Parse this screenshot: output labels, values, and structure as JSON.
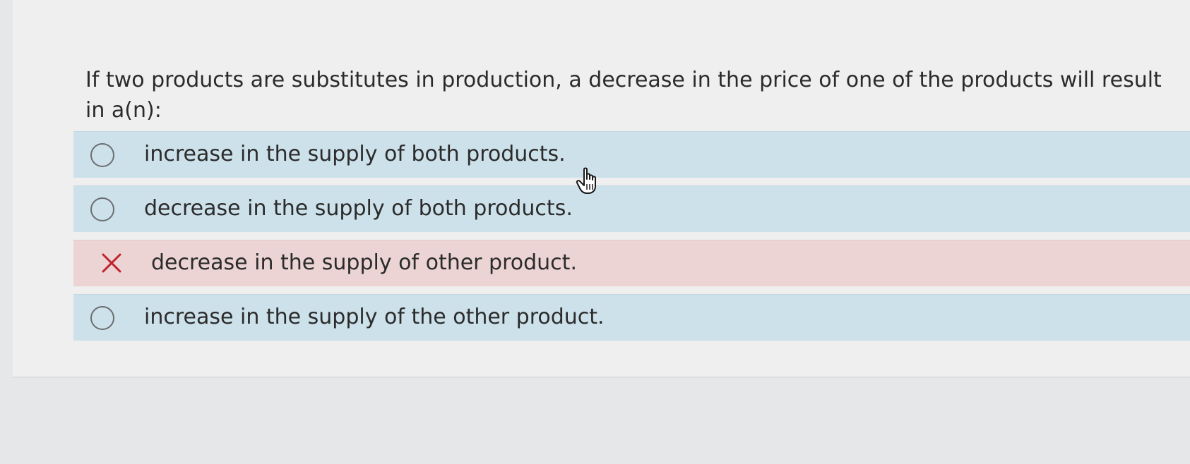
{
  "question": {
    "text": "If two products are substitutes in production, a decrease in the price of one of the products will result in a(n):"
  },
  "options": [
    {
      "label": "increase in the supply of both products.",
      "state": "unselected",
      "icon": "radio-empty"
    },
    {
      "label": "decrease in the supply of both products.",
      "state": "unselected",
      "icon": "radio-empty"
    },
    {
      "label": "decrease in the supply of other product.",
      "state": "incorrect",
      "icon": "x-icon"
    },
    {
      "label": "increase in the supply of the other product.",
      "state": "unselected",
      "icon": "radio-empty"
    }
  ],
  "colors": {
    "option_bg": "#cde1ea",
    "incorrect_bg": "#ecd4d5",
    "incorrect_mark": "#c0242c",
    "text": "#2b2b2b"
  },
  "cursor": {
    "icon": "hand-pointer-icon"
  }
}
